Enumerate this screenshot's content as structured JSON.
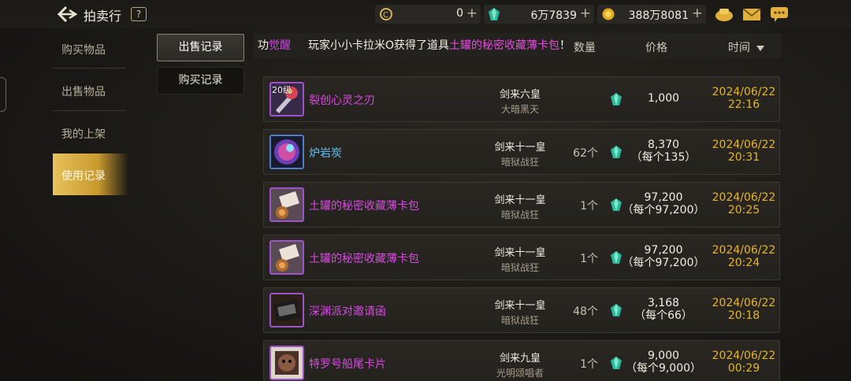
{
  "header": {
    "title": "拍卖行",
    "help": "?",
    "currencies": [
      {
        "icon": "gold-coin-icon",
        "value": "0"
      },
      {
        "icon": "green-gem-icon",
        "value": "6万7839"
      },
      {
        "icon": "yellow-coin-icon",
        "value": "388万8081"
      }
    ],
    "plus": "+"
  },
  "nav": {
    "items": [
      "购买物品",
      "出售物品",
      "我的上架",
      "使用记录"
    ],
    "active": "使用记录"
  },
  "subtabs": {
    "sell": "出售记录",
    "buy": "购买记录"
  },
  "marquee": {
    "prefix_fragment": "功",
    "cut_fragment": "觉醒",
    "text": "玩家小小卡拉米O获得了道具",
    "item": "土罐的秘密收藏薄卡包",
    "suffix": "！"
  },
  "columns": {
    "qty": "数量",
    "price": "价格",
    "time": "时间"
  },
  "rows": [
    {
      "level": "20级",
      "name": "裂创心灵之刃",
      "name_color": "#d84ae0",
      "seller_title": "剑来六皇",
      "seller_guild": "大暗黑天",
      "qty": "",
      "price": "1,000",
      "unit": "",
      "date": "2024/06/22",
      "time": "22:16"
    },
    {
      "level": "",
      "name": "炉岩炭",
      "name_color": "#5ec0f0",
      "seller_title": "剑来十一皇",
      "seller_guild": "暗狱战狂",
      "qty": "62个",
      "price": "8,370",
      "unit": "（每个135）",
      "date": "2024/06/22",
      "time": "20:31"
    },
    {
      "level": "",
      "name": "土罐的秘密收藏薄卡包",
      "name_color": "#d84ae0",
      "seller_title": "剑来十一皇",
      "seller_guild": "暗狱战狂",
      "qty": "1个",
      "price": "97,200",
      "unit": "（每个97,200）",
      "date": "2024/06/22",
      "time": "20:25"
    },
    {
      "level": "",
      "name": "土罐的秘密收藏薄卡包",
      "name_color": "#d84ae0",
      "seller_title": "剑来十一皇",
      "seller_guild": "暗狱战狂",
      "qty": "1个",
      "price": "97,200",
      "unit": "（每个97,200）",
      "date": "2024/06/22",
      "time": "20:24"
    },
    {
      "level": "",
      "name": "深渊派对邀请函",
      "name_color": "#d84ae0",
      "seller_title": "剑来十一皇",
      "seller_guild": "暗狱战狂",
      "qty": "48个",
      "price": "3,168",
      "unit": "（每个66）",
      "date": "2024/06/22",
      "time": "20:18"
    },
    {
      "level": "",
      "name": "特罗号船尾卡片",
      "name_color": "#d84ae0",
      "seller_title": "剑来九皇",
      "seller_guild": "光明颂唱者",
      "qty": "1个",
      "price": "9,000",
      "unit": "（每个9,000）",
      "date": "2024/06/22",
      "time": "00:29"
    }
  ]
}
